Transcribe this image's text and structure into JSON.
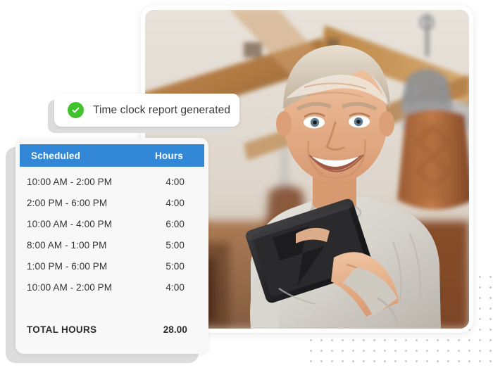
{
  "toast": {
    "icon": "check-circle-icon",
    "message": "Time clock report generated",
    "icon_color": "#41c32e"
  },
  "schedule_card": {
    "accent_color": "#3288d6",
    "columns": [
      {
        "key": "scheduled",
        "label": "Scheduled"
      },
      {
        "key": "hours",
        "label": "Hours"
      }
    ],
    "rows": [
      {
        "scheduled": "10:00 AM - 2:00 PM",
        "hours": "4:00"
      },
      {
        "scheduled": "2:00 PM - 6:00 PM",
        "hours": "4:00"
      },
      {
        "scheduled": "10:00 AM - 4:00 PM",
        "hours": "6:00"
      },
      {
        "scheduled": "8:00 AM - 1:00 PM",
        "hours": "5:00"
      },
      {
        "scheduled": "1:00 PM - 6:00 PM",
        "hours": "5:00"
      },
      {
        "scheduled": "10:00 AM - 2:00 PM",
        "hours": "4:00"
      }
    ],
    "total": {
      "label": "TOTAL HOURS",
      "value": "28.00"
    }
  },
  "photo": {
    "alt": "Smiling older man in a gray sweatshirt holding a tablet inside a gym with wooden roof beams and hanging leather punching bags"
  }
}
